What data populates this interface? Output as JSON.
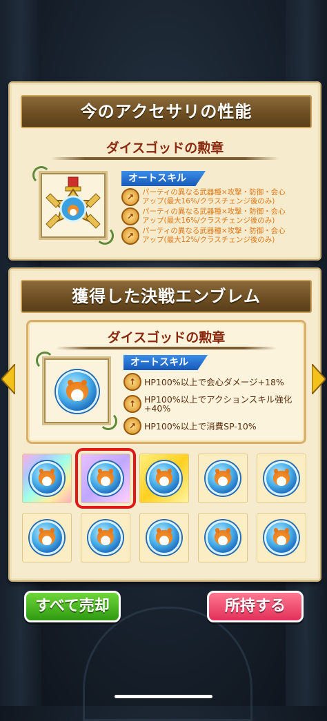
{
  "accessory_panel": {
    "title": "今のアクセサリの性能",
    "item_name": "ダイスゴッドの勲章",
    "skill_tag": "オートスキル",
    "skills": [
      "パーティの異なる武器種×攻撃・防御・会心アップ(最大16%/クラスチェンジ後のみ)",
      "パーティの異なる武器種×攻撃・防御・会心アップ(最大16%/クラスチェンジ後のみ)",
      "パーティの異なる武器種×攻撃・防御・会心アップ(最大12%/クラスチェンジ後のみ)"
    ]
  },
  "emblem_panel": {
    "title": "獲得した決戦エンブレム",
    "item_name": "ダイスゴッドの勲章",
    "skill_tag": "オートスキル",
    "skills": [
      "HP100%以上で会心ダメージ+18%",
      "HP100%以上でアクションスキル強化+40%",
      "HP100%以上で消費SP-10%"
    ],
    "selected_index": 1
  },
  "buttons": {
    "sell_all": "すべて売却",
    "keep": "所持する"
  },
  "colors": {
    "header_brown": "#6e4f24",
    "selection_red": "#e01818",
    "sell_green": "#2f9a12",
    "keep_pink": "#e2305a",
    "skill_tag_blue": "#1758b8"
  }
}
